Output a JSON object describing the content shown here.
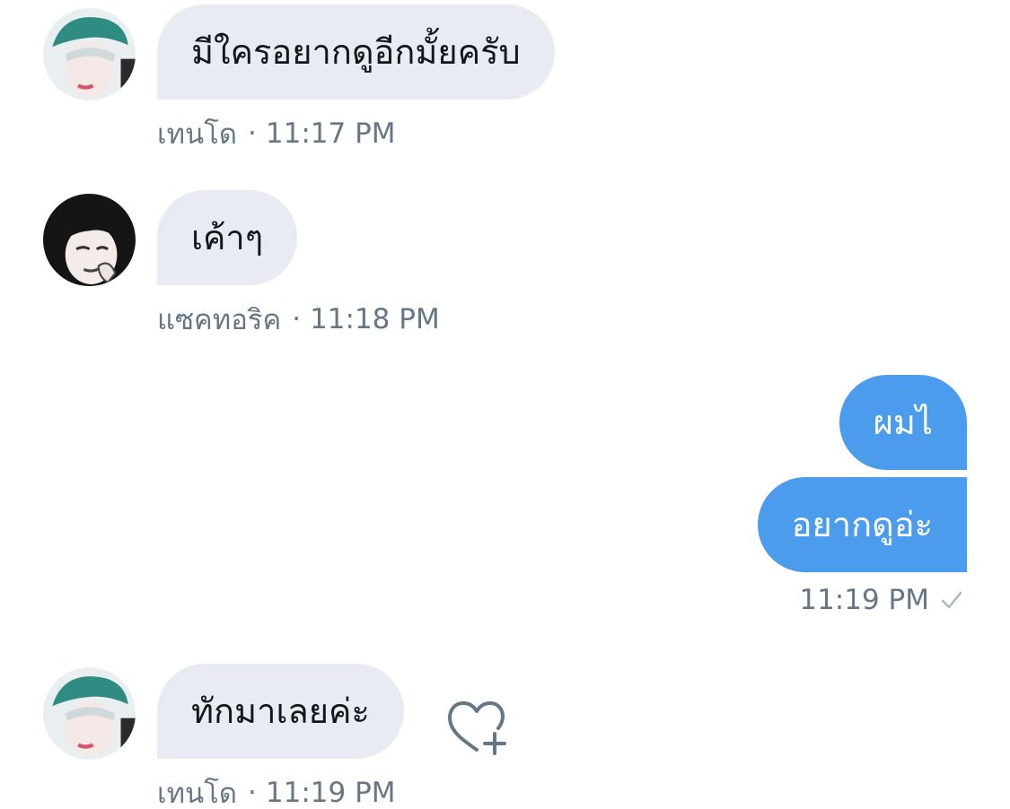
{
  "messages": [
    {
      "sender": "เทนโด",
      "text": "มีใครอยากดูอีกมั้ยครับ",
      "time": "11:17 PM"
    },
    {
      "sender": "แซคทอริค",
      "text": "เค้าๆ",
      "time": "11:18 PM"
    },
    {
      "outgoing": [
        "ผมไ",
        "อยากดูอ่ะ"
      ],
      "time": "11:19 PM",
      "status_icon": "check-icon"
    },
    {
      "sender": "เทนโด",
      "text": "ทักมาเลยค่ะ",
      "time": "11:19 PM",
      "reaction_icon": "heart-add-icon"
    }
  ],
  "separator": "·",
  "colors": {
    "incoming_bubble": "#e8ebf2",
    "outgoing_bubble": "#4b9cec",
    "meta_text": "#657786"
  }
}
